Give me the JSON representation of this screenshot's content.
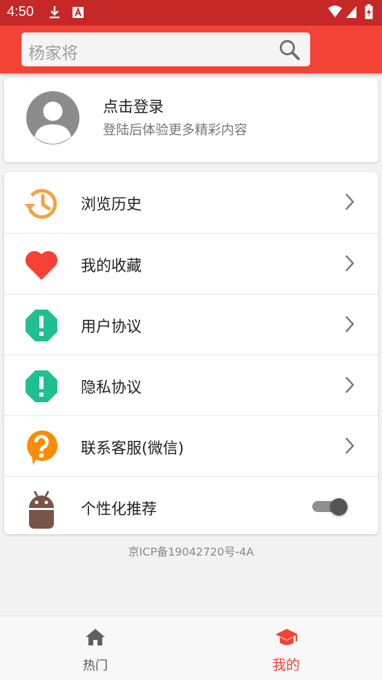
{
  "status_bar": {
    "time": "4:50"
  },
  "search": {
    "placeholder": "杨家将"
  },
  "login": {
    "title": "点击登录",
    "subtitle": "登陆后体验更多精彩内容"
  },
  "menu": {
    "items": [
      {
        "label": "浏览历史",
        "icon": "history-icon"
      },
      {
        "label": "我的收藏",
        "icon": "heart-icon"
      },
      {
        "label": "用户协议",
        "icon": "alert-octagon-icon"
      },
      {
        "label": "隐私协议",
        "icon": "alert-octagon-icon"
      },
      {
        "label": "联系客服(微信)",
        "icon": "help-bubble-icon"
      },
      {
        "label": "个性化推荐",
        "icon": "android-icon",
        "toggle_on": true
      }
    ]
  },
  "footer": {
    "icp": "京ICP备19042720号-4A"
  },
  "tabs": [
    {
      "label": "热门",
      "icon": "home-icon",
      "active": false
    },
    {
      "label": "我的",
      "icon": "graduation-cap-icon",
      "active": true
    }
  ],
  "colors": {
    "status_bar": "#c62828",
    "header": "#f44336",
    "accent": "#f44336",
    "history": "#f4a340",
    "heart": "#f44336",
    "alert": "#1fbf8f",
    "help": "#fb8c00",
    "android": "#795548"
  }
}
